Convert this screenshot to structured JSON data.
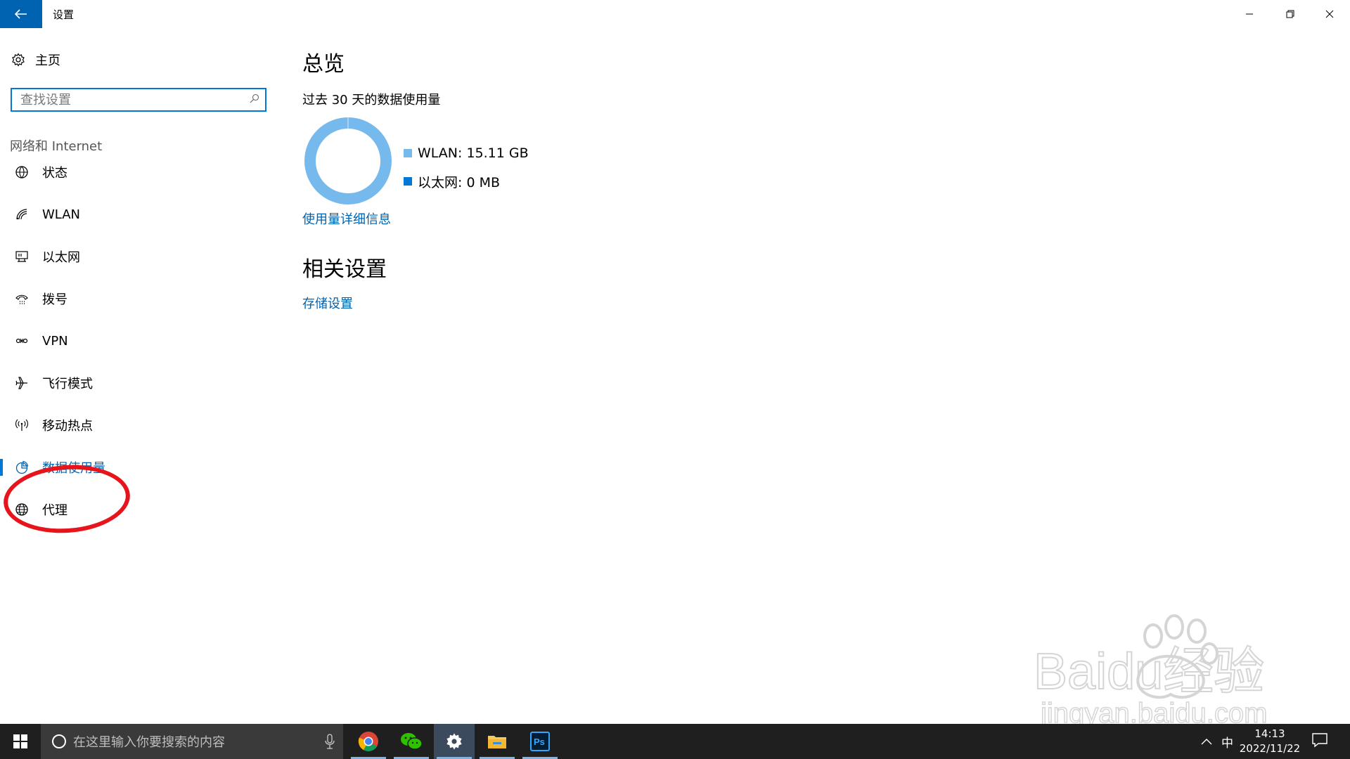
{
  "window": {
    "title": "设置",
    "back_icon": "arrow-left-icon",
    "controls": [
      "minimize-icon",
      "maximize-icon",
      "close-icon"
    ]
  },
  "sidebar": {
    "home_label": "主页",
    "search_placeholder": "查找设置",
    "section_title": "网络和 Internet",
    "items": [
      {
        "label": "状态",
        "icon": "globe-status-icon"
      },
      {
        "label": "WLAN",
        "icon": "wifi-icon"
      },
      {
        "label": "以太网",
        "icon": "ethernet-icon"
      },
      {
        "label": "拨号",
        "icon": "dialup-icon"
      },
      {
        "label": "VPN",
        "icon": "vpn-icon"
      },
      {
        "label": "飞行模式",
        "icon": "airplane-icon"
      },
      {
        "label": "移动热点",
        "icon": "hotspot-icon"
      },
      {
        "label": "数据使用量",
        "icon": "pie-chart-icon",
        "active": true
      },
      {
        "label": "代理",
        "icon": "globe-icon"
      }
    ]
  },
  "main": {
    "title": "总览",
    "subtitle": "过去 30 天的数据使用量",
    "usage": {
      "wlan_label": "WLAN: 15.11 GB",
      "ethernet_label": "以太网: 0 MB",
      "wlan_color": "#76b9ed",
      "ethernet_color": "#0078d7"
    },
    "details_link": "使用量详细信息",
    "related_title": "相关设置",
    "storage_link": "存储设置"
  },
  "taskbar": {
    "search_placeholder": "在这里输入你要搜索的内容",
    "apps": [
      "chrome-icon",
      "wechat-icon",
      "settings-icon",
      "file-explorer-icon",
      "photoshop-icon"
    ],
    "ime": "中",
    "time": "14:13",
    "date": "2022/11/22"
  },
  "watermark": {
    "brand": "Baidu经验",
    "url": "jingyan.baidu.com"
  }
}
